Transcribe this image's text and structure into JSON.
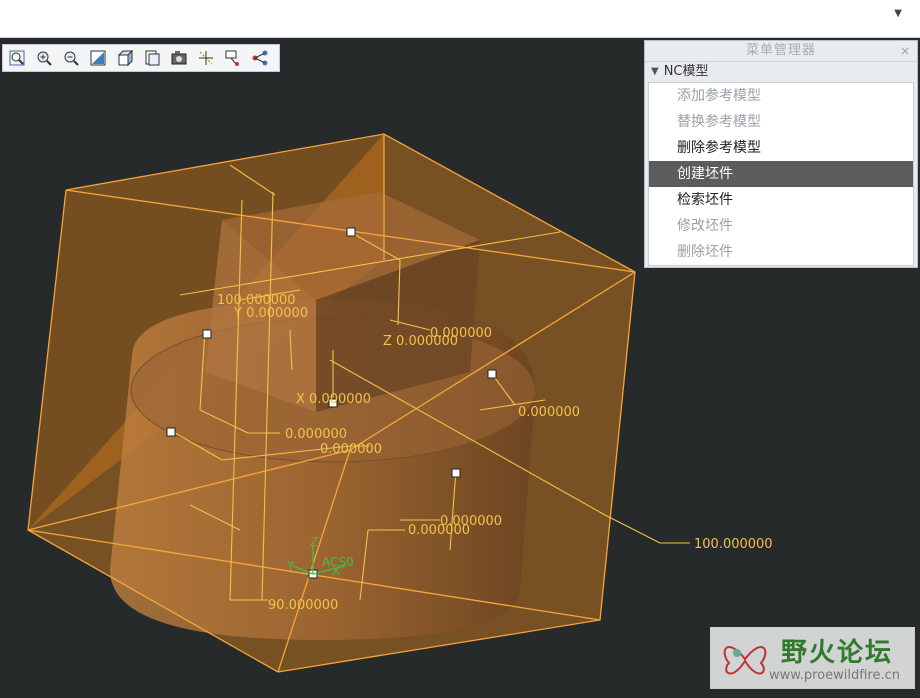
{
  "toolbar": {
    "icons": [
      "zoom-fit-icon",
      "zoom-in-icon",
      "zoom-out-icon",
      "repaint-icon",
      "display-style-icon",
      "saved-views-icon",
      "camera-icon",
      "datum-display-icon",
      "annotation-display-icon",
      "spin-center-icon"
    ]
  },
  "menu_manager": {
    "title": "菜单管理器",
    "close": "×",
    "section": "NC模型",
    "items": [
      {
        "label": "添加参考模型",
        "state": "disabled"
      },
      {
        "label": "替换参考模型",
        "state": "disabled"
      },
      {
        "label": "删除参考模型",
        "state": "enabled"
      },
      {
        "label": "创建坯件",
        "state": "selected"
      },
      {
        "label": "检索坯件",
        "state": "enabled"
      },
      {
        "label": "修改坯件",
        "state": "disabled"
      },
      {
        "label": "删除坯件",
        "state": "disabled"
      }
    ]
  },
  "model_view": {
    "dimensions": [
      {
        "id": "d1",
        "text": "100.000000"
      },
      {
        "id": "d2",
        "text": "Y 0.000000"
      },
      {
        "id": "d3",
        "text": "0.000000"
      },
      {
        "id": "d4",
        "text": "Z 0.000000"
      },
      {
        "id": "d5",
        "text": "X 0.000000"
      },
      {
        "id": "d6",
        "text": "0.000000"
      },
      {
        "id": "d7",
        "text": "0.000000"
      },
      {
        "id": "d8",
        "text": "0.000000"
      },
      {
        "id": "d9",
        "text": "0.000000"
      },
      {
        "id": "d10",
        "text": "0.000000"
      },
      {
        "id": "d11",
        "text": "100.000000"
      },
      {
        "id": "d12",
        "text": "90.000000"
      }
    ],
    "csys": {
      "name": "ACS0",
      "x": "X",
      "y": "Y",
      "z": "Z"
    }
  },
  "colors": {
    "background": "#262a2b",
    "workpiece_fill": "#f0a030",
    "edge": "#f6a53a",
    "dimension": "#f2c24a",
    "csys": "#3bc04a"
  },
  "watermark": {
    "cn": "野火论坛",
    "url": "www.proewildfire.cn"
  }
}
